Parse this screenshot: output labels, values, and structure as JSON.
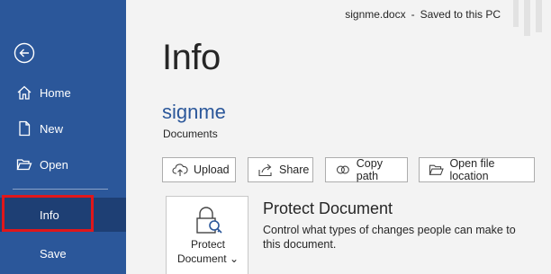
{
  "sidebar": {
    "back_icon": "back-arrow-icon",
    "items": [
      {
        "label": "Home",
        "icon": "home-icon"
      },
      {
        "label": "New",
        "icon": "new-document-icon"
      },
      {
        "label": "Open",
        "icon": "folder-open-icon"
      },
      {
        "label": "Info",
        "selected": true
      },
      {
        "label": "Save"
      }
    ],
    "colors": {
      "background": "#2b579a",
      "selected": "#1e3f74",
      "highlight": "#e0171b"
    }
  },
  "title_bar": {
    "filename": "signme.docx",
    "separator": "-",
    "status": "Saved to this PC"
  },
  "main": {
    "title": "Info",
    "doc_name": "signme",
    "location": "Documents",
    "actions": [
      {
        "label": "Upload",
        "icon": "upload-cloud-icon"
      },
      {
        "label": "Share",
        "icon": "share-icon"
      },
      {
        "label": "Copy path",
        "icon": "link-icon"
      },
      {
        "label": "Open file location",
        "icon": "folder-icon"
      }
    ],
    "protect": {
      "button_line1": "Protect",
      "button_line2": "Document",
      "dropdown_glyph": "⌄",
      "icon": "lock-key-icon",
      "heading": "Protect Document",
      "description": "Control what types of changes people can make to this document."
    }
  }
}
